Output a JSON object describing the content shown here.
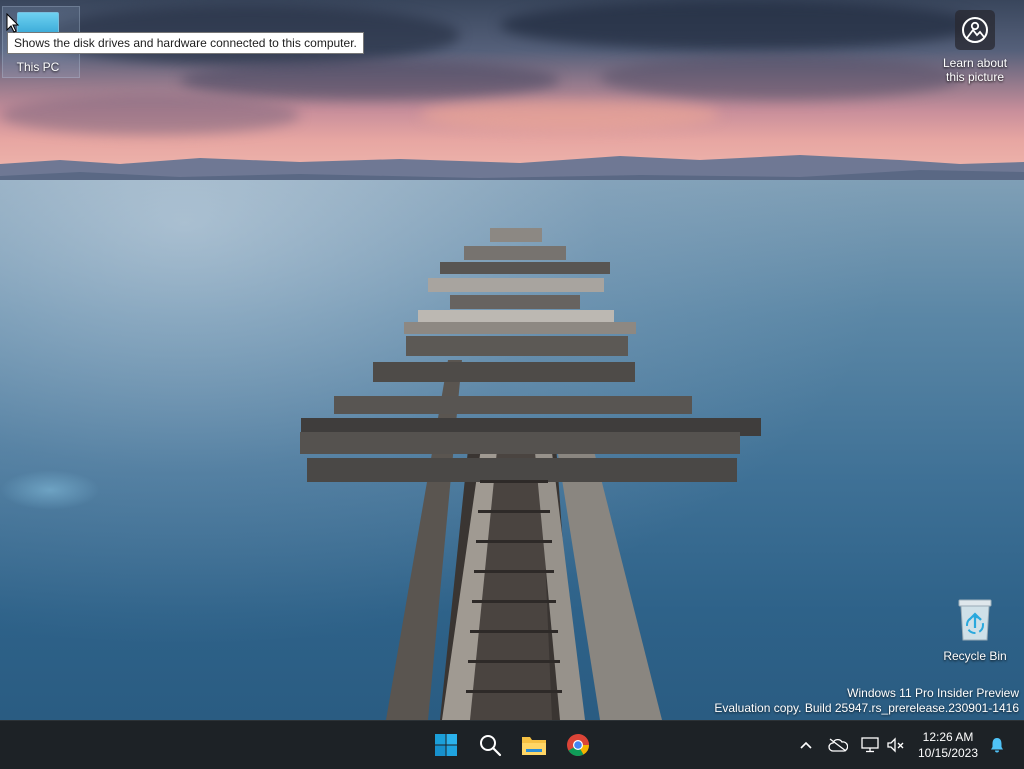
{
  "desktop": {
    "icons": [
      {
        "label": "This PC"
      },
      {
        "label": "Recycle Bin"
      }
    ],
    "tooltip": "Shows the disk drives and hardware connected to this computer.",
    "learn": {
      "line1": "Learn about",
      "line2": "this picture"
    },
    "watermark": {
      "line1": "Windows 11 Pro Insider Preview",
      "line2": "Evaluation copy. Build 25947.rs_prerelease.230901-1416"
    }
  },
  "taskbar": {
    "pinned": [
      {
        "icon": "windows-start-icon"
      },
      {
        "icon": "search-icon"
      },
      {
        "icon": "file-explorer-icon"
      },
      {
        "icon": "chrome-icon"
      }
    ],
    "tray": {
      "time": "12:26 AM",
      "date": "10/15/2023"
    }
  },
  "colors": {
    "taskbar": "#1d2226",
    "start_blue": "#1b9fd9",
    "chrome_red": "#db4437",
    "chrome_green": "#0f9d58",
    "chrome_yellow": "#f4b400",
    "chrome_blue": "#4285f4",
    "bell": "#4fc3f7"
  }
}
